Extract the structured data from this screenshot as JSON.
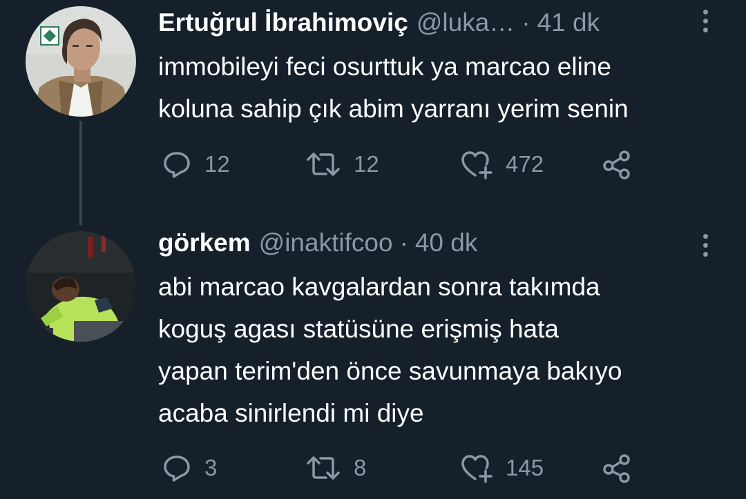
{
  "tweets": [
    {
      "display_name": "Ertuğrul İbrahimoviç",
      "handle": "@luka…",
      "separator": "·",
      "time": "41 dk",
      "lines": [
        "immobileyi feci osurttuk ya marcao eline",
        "koluna sahip çık abim yarranı yerim senin"
      ],
      "replies": "12",
      "retweets": "12",
      "likes": "472"
    },
    {
      "display_name": "görkem",
      "handle": "@inaktifcoo",
      "separator": "·",
      "time": "40 dk",
      "lines": [
        "abi marcao kavgalardan sonra takımda",
        "koguş agası statüsüne erişmiş hata",
        "yapan terim'den önce savunmaya bakıyo",
        "acaba sinirlendi mi diye"
      ],
      "replies": "3",
      "retweets": "8",
      "likes": "145"
    }
  ],
  "colors": {
    "background": "#15202b",
    "text_primary": "#ffffff",
    "text_secondary": "#8b98a5",
    "thread_line": "#38444d"
  },
  "icons": [
    "reply-icon",
    "retweet-icon",
    "like-icon",
    "share-icon",
    "more-options-icon"
  ]
}
